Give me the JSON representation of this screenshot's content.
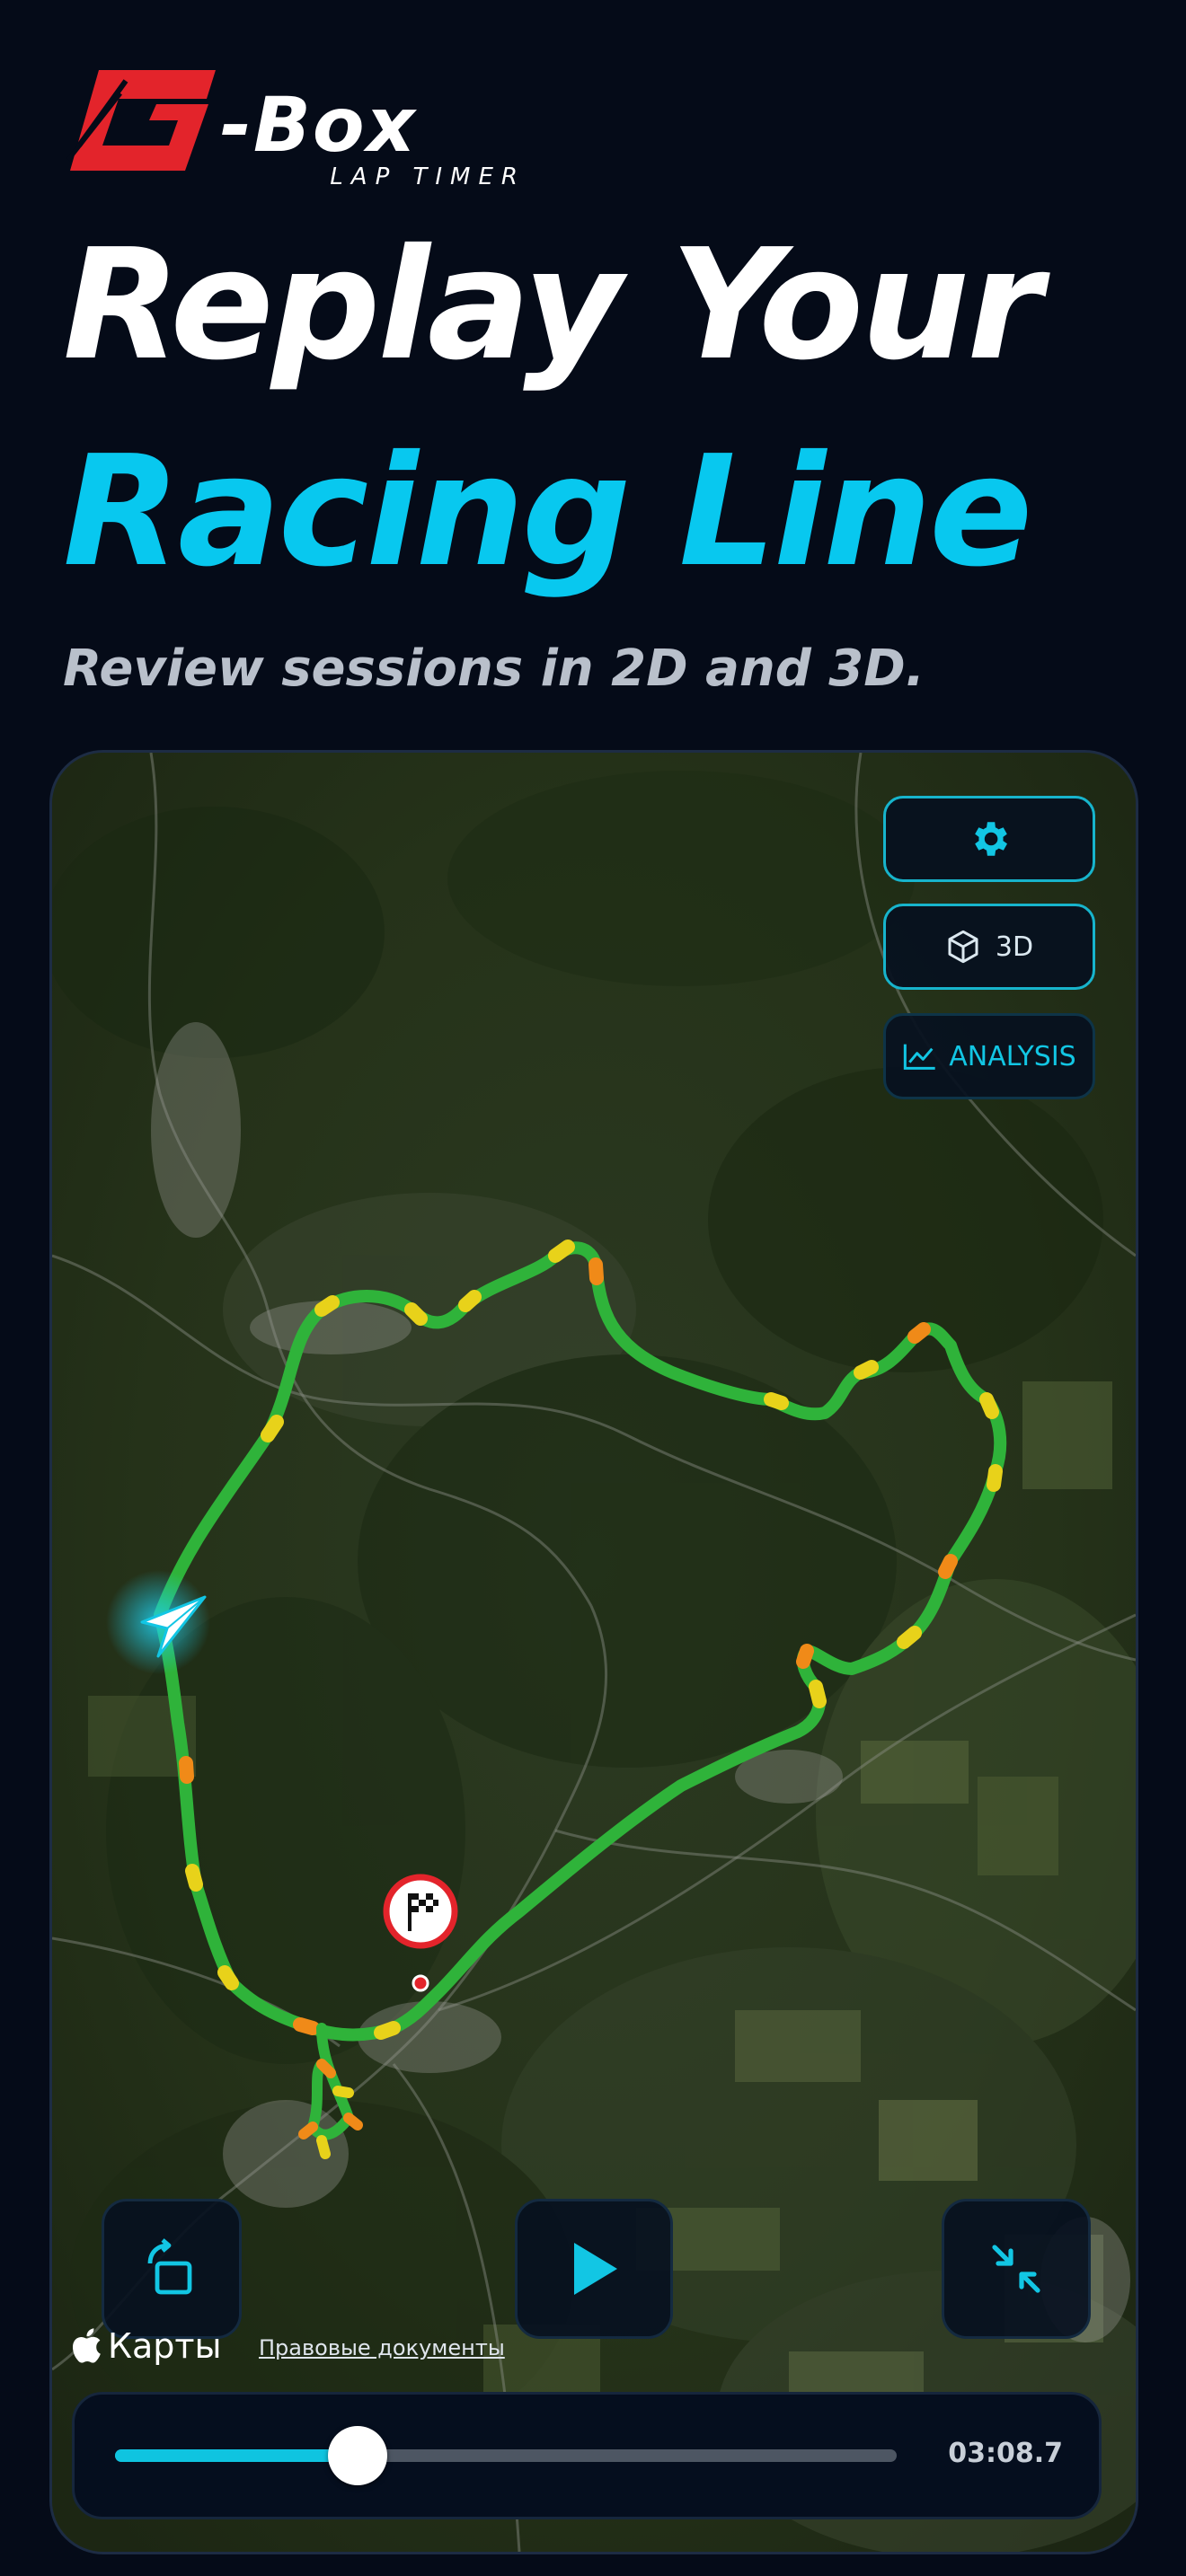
{
  "brand": {
    "name": "-Box",
    "tagline": "LAP TIMER",
    "logo_red": "#e3242b",
    "logo_letter": "G"
  },
  "headline": {
    "line1": "Replay Your",
    "line2": "Racing Line",
    "subtitle": "Review sessions in 2D and 3D."
  },
  "map_controls": {
    "settings_icon": "gear-icon",
    "view_3d_label": "3D",
    "view_3d_icon": "cube-icon",
    "analysis_label": "ANALYSIS",
    "analysis_icon": "chart-line-icon"
  },
  "map_footer": {
    "maps_brand": "Карты",
    "legal_link": "Правовые документы"
  },
  "playback": {
    "rotate_icon": "rotate-screen-icon",
    "play_icon": "play-icon",
    "collapse_icon": "collapse-icon",
    "progress": 0.31,
    "time": "03:08.7"
  },
  "colors": {
    "background": "#050b18",
    "accent": "#08c8ef",
    "track_green": "#2fb33a",
    "track_yellow": "#e8d21a",
    "track_orange": "#f08a18"
  }
}
